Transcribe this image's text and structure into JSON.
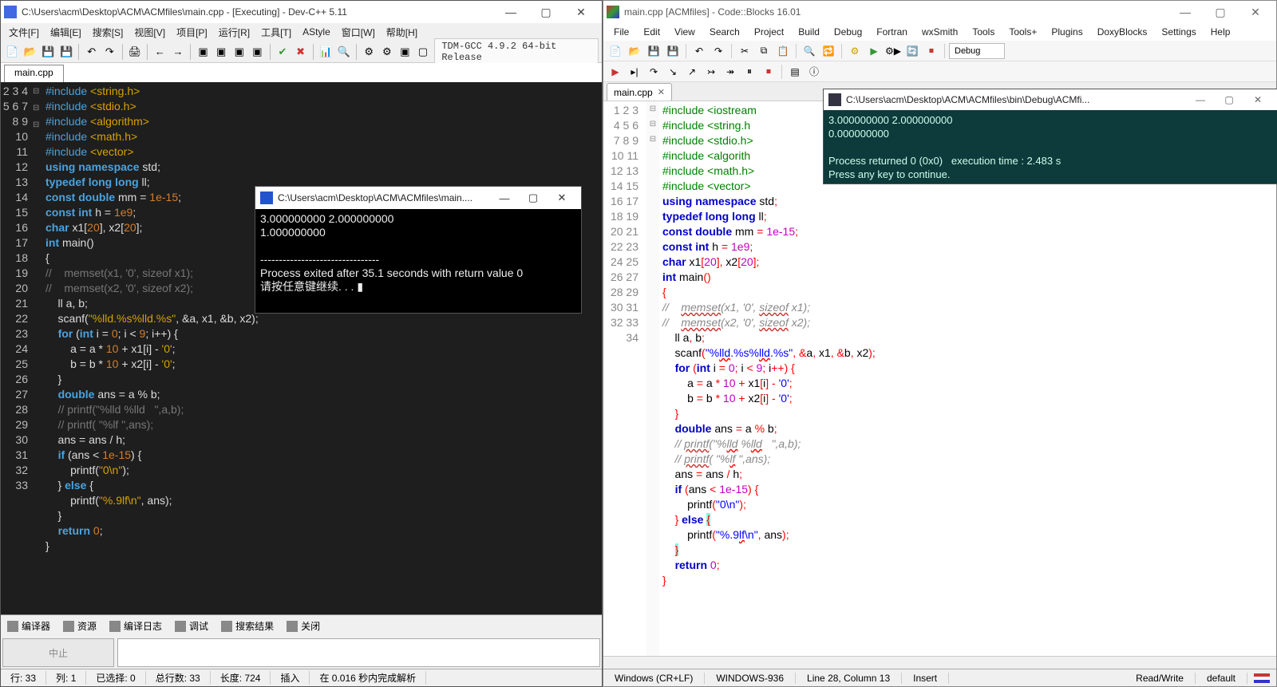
{
  "devcpp": {
    "title": "C:\\Users\\acm\\Desktop\\ACM\\ACMfiles\\main.cpp - [Executing] - Dev-C++ 5.11",
    "menu": [
      "文件[F]",
      "编辑[E]",
      "搜索[S]",
      "视图[V]",
      "项目[P]",
      "运行[R]",
      "工具[T]",
      "AStyle",
      "窗口[W]",
      "帮助[H]"
    ],
    "compiler_label": "TDM-GCC 4.9.2 64-bit Release",
    "tab": "main.cpp",
    "lines": [
      "2",
      "3",
      "4",
      "5",
      "6",
      "7",
      "8",
      "9",
      "10",
      "11",
      "12",
      "13",
      "14",
      "15",
      "16",
      "17",
      "18",
      "19",
      "20",
      "21",
      "22",
      "23",
      "24",
      "25",
      "26",
      "27",
      "28",
      "29",
      "30",
      "31",
      "32",
      "33"
    ],
    "code_html": [
      "<span class='pp'>#include</span> <span class='str'>&lt;string.h&gt;</span>",
      "<span class='pp'>#include</span> <span class='str'>&lt;stdio.h&gt;</span>",
      "<span class='pp'>#include</span> <span class='str'>&lt;algorithm&gt;</span>",
      "<span class='pp'>#include</span> <span class='str'>&lt;math.h&gt;</span>",
      "<span class='pp'>#include</span> <span class='str'>&lt;vector&gt;</span>",
      "<span class='kw'>using</span> <span class='kw'>namespace</span> std;",
      "<span class='kw'>typedef</span> <span class='kw'>long</span> <span class='kw'>long</span> ll;",
      "<span class='kw'>const</span> <span class='kw'>double</span> mm = <span class='num'>1e-15</span>;",
      "<span class='kw'>const</span> <span class='kw'>int</span> h = <span class='num'>1e9</span>;",
      "<span class='kw'>char</span> x1[<span class='num'>20</span>], x2[<span class='num'>20</span>];",
      "<span class='kw'>int</span> main()",
      "{",
      "<span class='cm'>//    memset(x1, '0', sizeof x1);</span>",
      "<span class='cm'>//    memset(x2, '0', sizeof x2);</span>",
      "    ll a, b;",
      "    scanf(<span class='str'>\"%lld.%s%lld.%s\"</span>, &a, x1, &b, x2);",
      "    <span class='kw'>for</span> (<span class='kw'>int</span> i = <span class='num'>0</span>; i &lt; <span class='num'>9</span>; i++) {",
      "        a = a * <span class='num'>10</span> + x1[i] - <span class='str'>'0'</span>;",
      "        b = b * <span class='num'>10</span> + x2[i] - <span class='str'>'0'</span>;",
      "    }",
      "    <span class='kw'>double</span> ans = a % b;",
      "    <span class='cm'>// printf(\"%lld %lld   \",a,b);</span>",
      "    <span class='cm'>// printf( \"%lf \",ans);</span>",
      "    ans = ans / h;",
      "    <span class='kw'>if</span> (ans &lt; <span class='num'>1e-15</span>) {",
      "        printf(<span class='str'>\"0\\n\"</span>);",
      "    } <span class='kw'>else</span> {",
      "        printf(<span class='str'>\"%.9lf\\n\"</span>, ans);",
      "    }",
      "    <span class='kw'>return</span> <span class='num'>0</span>;",
      "}",
      ""
    ],
    "bottom_tabs": [
      "编译器",
      "资源",
      "编译日志",
      "调试",
      "搜索结果",
      "关闭"
    ],
    "abort_label": "中止",
    "status": {
      "line": "行:  33",
      "col": "列:   1",
      "sel": "已选择:   0",
      "total": "总行数:   33",
      "len": "长度:   724",
      "mode": "插入",
      "parse": "在 0.016 秒内完成解析"
    },
    "console": {
      "title": "C:\\Users\\acm\\Desktop\\ACM\\ACMfiles\\main....",
      "body": "3.000000000 2.000000000\n1.000000000\n\n--------------------------------\nProcess exited after 35.1 seconds with return value 0\n请按任意键继续. . . ▮"
    }
  },
  "cb": {
    "title": "main.cpp [ACMfiles] - Code::Blocks 16.01",
    "menu": [
      "File",
      "Edit",
      "View",
      "Search",
      "Project",
      "Build",
      "Debug",
      "Fortran",
      "wxSmith",
      "Tools",
      "Tools+",
      "Plugins",
      "DoxyBlocks",
      "Settings",
      "Help"
    ],
    "build_target": "Debug",
    "tab": "main.cpp",
    "lines": [
      "1",
      "2",
      "3",
      "4",
      "5",
      "6",
      "7",
      "8",
      "9",
      "10",
      "11",
      "12",
      "13",
      "14",
      "15",
      "16",
      "17",
      "18",
      "19",
      "20",
      "21",
      "22",
      "23",
      "24",
      "25",
      "26",
      "27",
      "28",
      "29",
      "30",
      "31",
      "32",
      "33",
      "34"
    ],
    "code_html": [
      "<span class='pp2'>#include &lt;iostream</span>",
      "<span class='pp2'>#include &lt;string.h</span>",
      "<span class='pp2'>#include &lt;stdio.h&gt;</span>",
      "<span class='pp2'>#include &lt;algorith</span>",
      "<span class='pp2'>#include &lt;math.h&gt;</span>",
      "<span class='pp2'>#include &lt;vector&gt;</span>",
      "<span class='kw2'>using namespace</span> std<span class='op2'>;</span>",
      "<span class='kw2'>typedef long long</span> ll<span class='op2'>;</span>",
      "<span class='kw2'>const double</span> mm <span class='op2'>=</span> <span class='num2'>1e-15</span><span class='op2'>;</span>",
      "<span class='kw2'>const int</span> h <span class='op2'>=</span> <span class='num2'>1e9</span><span class='op2'>;</span>",
      "<span class='kw2'>char</span> x1<span class='op2'>[</span><span class='num2'>20</span><span class='op2'>],</span> x2<span class='op2'>[</span><span class='num2'>20</span><span class='op2'>];</span>",
      "<span class='kw2'>int</span> main<span class='op2'>()</span>",
      "<span class='op2'>{</span>",
      "<span class='cm2'>//    <span class='cmu'>memset</span>(x1, '0', <span class='cmu'>sizeof</span> x1);</span>",
      "<span class='cm2'>//    <span class='cmu'>memset</span>(x2, '0', <span class='cmu'>sizeof</span> x2);</span>",
      "    ll a<span class='op2'>,</span> b<span class='op2'>;</span>",
      "    scanf<span class='op2'>(</span><span class='str2'>\"%<u style='text-decoration:wavy underline red'>lld</u>.%s%<u style='text-decoration:wavy underline red'>lld</u>.%s\"</span><span class='op2'>, &amp;</span>a<span class='op2'>,</span> x1<span class='op2'>, &amp;</span>b<span class='op2'>,</span> x2<span class='op2'>);</span>",
      "    <span class='kw2'>for</span> <span class='op2'>(</span><span class='kw2'>int</span> i <span class='op2'>=</span> <span class='num2'>0</span><span class='op2'>;</span> i <span class='op2'>&lt;</span> <span class='num2'>9</span><span class='op2'>;</span> i<span class='op2'>++) {</span>",
      "        a <span class='op2'>=</span> a <span class='op2'>*</span> <span class='num2'>10</span> <span class='op2'>+</span> x1<span class='op2'>[</span>i<span class='op2'>] -</span> <span class='str2'>'0'</span><span class='op2'>;</span>",
      "        b <span class='op2'>=</span> b <span class='op2'>*</span> <span class='num2'>10</span> <span class='op2'>+</span> x2<span class='op2'>[</span>i<span class='op2'>] -</span> <span class='str2'>'0'</span><span class='op2'>;</span>",
      "    <span class='op2'>}</span>",
      "    <span class='kw2'>double</span> ans <span class='op2'>=</span> a <span class='op2'>%</span> b<span class='op2'>;</span>",
      "    <span class='cm2'>// <span class='cmu'>printf</span>(\"%<u style='text-decoration:wavy underline red'>lld</u> %<u style='text-decoration:wavy underline red'>lld</u>   \",a,b);</span>",
      "    <span class='cm2'>// <span class='cmu'>printf</span>( \"%<u style='text-decoration:wavy underline red'>lf</u> \",ans);</span>",
      "    ans <span class='op2'>=</span> ans <span class='op2'>/</span> h<span class='op2'>;</span>",
      "    <span class='kw2'>if</span> <span class='op2'>(</span>ans <span class='op2'>&lt;</span> <span class='num2'>1e-15</span><span class='op2'>) {</span>",
      "        printf<span class='op2'>(</span><span class='str2'>\"0\\n\"</span><span class='op2'>);</span>",
      "    <span class='op2'>}</span> <span class='kw2'>else</span> <span class='op2 braceH'>{</span>",
      "        printf<span class='op2'>(</span><span class='str2'>\"%.9<u style='text-decoration:wavy underline red'>lf</u>\\n\"</span><span class='op2'>,</span> ans<span class='op2'>);</span>",
      "    <span class='op2 braceH'>}</span>",
      "    <span class='kw2'>return</span> <span class='num2'>0</span><span class='op2'>;</span>",
      "<span class='op2'>}</span>",
      "",
      ""
    ],
    "status": {
      "eol": "Windows (CR+LF)",
      "enc": "WINDOWS-936",
      "pos": "Line 28, Column 13",
      "ins": "Insert",
      "rw": "Read/Write",
      "profile": "default"
    },
    "console": {
      "title": "C:\\Users\\acm\\Desktop\\ACM\\ACMfiles\\bin\\Debug\\ACMfi...",
      "body": "3.000000000 2.000000000\n0.000000000\n\nProcess returned 0 (0x0)   execution time : 2.483 s\nPress any key to continue."
    }
  }
}
